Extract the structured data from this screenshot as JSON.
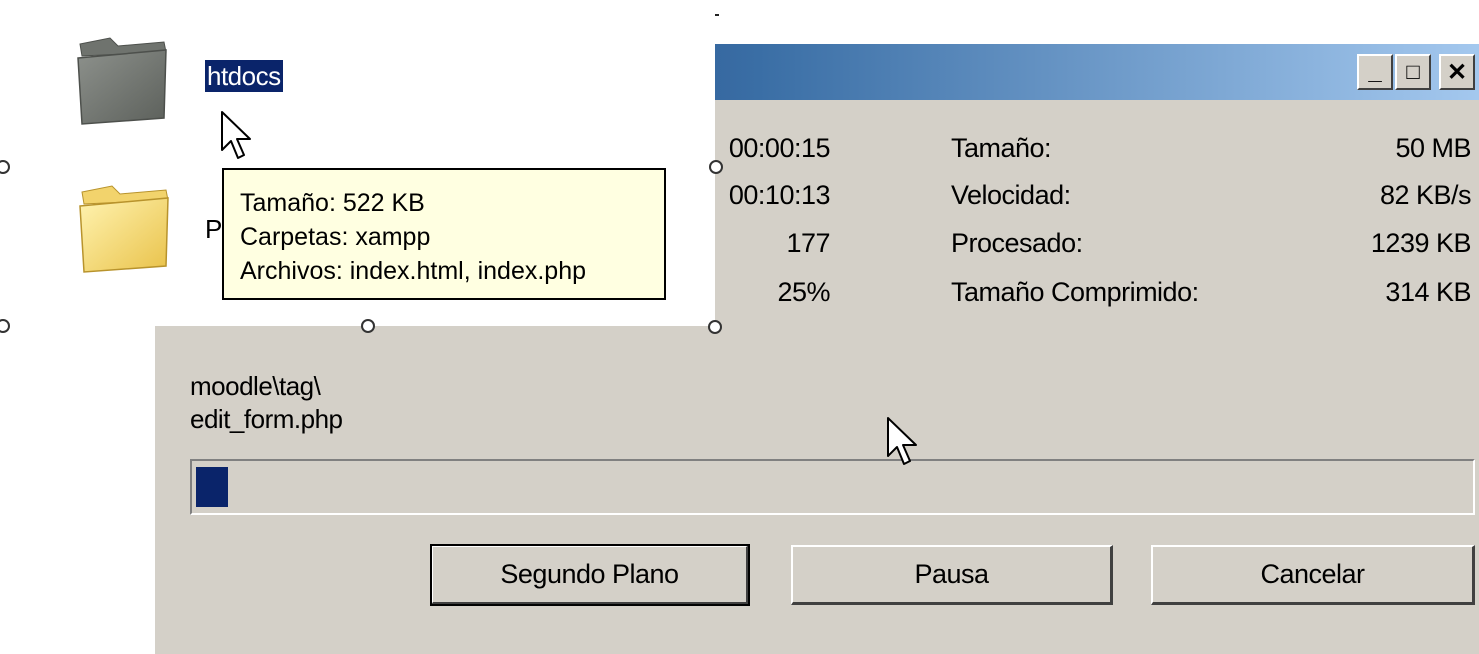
{
  "window_controls": {
    "minimize_glyph": "_",
    "maximize_glyph": "□",
    "close_glyph": "✕"
  },
  "stats_left": {
    "elapsed": "00:00:15",
    "remaining": "00:10:13",
    "files": "177",
    "percent": "25%"
  },
  "stats_right": {
    "labels": [
      "Tamaño:",
      "Velocidad:",
      "Procesado:",
      "Tamaño Comprimido:"
    ],
    "values": [
      "50 MB",
      "82 KB/s",
      "1239 KB",
      "314 KB"
    ]
  },
  "current_file": {
    "line1": "moodle\\tag\\",
    "line2": "edit_form.php"
  },
  "progress": {
    "fraction": 0.025
  },
  "buttons": {
    "background": "Segundo Plano",
    "pause": "Pausa",
    "cancel": "Cancelar"
  },
  "explorer": {
    "selected_folder_name": "htdocs",
    "second_folder_partial": "P"
  },
  "tooltip": {
    "line1": "Tamaño: 522 KB",
    "line2": "Carpetas: xampp",
    "line3": "Archivos: index.html, index.php"
  },
  "colors": {
    "dialog_bg": "#d4d0c8",
    "titlebar_start": "#0a246a",
    "titlebar_end": "#a6caf0",
    "progress_fill": "#0a246a",
    "tooltip_bg": "#ffffe1",
    "selection_bg": "#0a246a"
  },
  "icons": [
    "gray-folder-icon",
    "yellow-folder-icon",
    "mouse-cursor-icon"
  ]
}
